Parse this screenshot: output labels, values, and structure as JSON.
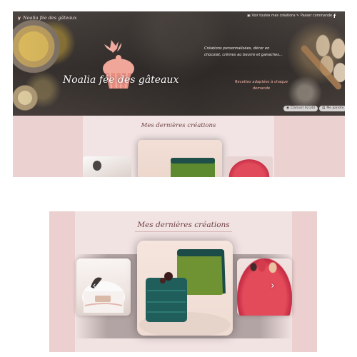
{
  "site": {
    "logo_text": "Noalia fée des gâteaux",
    "brand_name": "Noalia fée des gâteaux",
    "nav": {
      "creations": "Voir toutes mes créations",
      "contact": "Passer commande",
      "facebook": "f"
    },
    "tagline": "Créations personnalisées, décor en chocolat, crèmes au beurre et ganaches...",
    "subtagline": "Recettes adaptées à chaque demande",
    "pills": {
      "location": "Clamart 92140",
      "contact": "Me joindre"
    }
  },
  "gallery": {
    "title": "Mes dernières créations",
    "arrows": {
      "prev": "‹",
      "next": "›"
    },
    "images": [
      "white-cake-photo",
      "green-and-teal-cake-squares-photo",
      "red-glazed-entremet-photo"
    ]
  },
  "colors": {
    "hero_dark": "#3b3532",
    "accent_pink": "#f0a79a",
    "section_pink": "#ecd1d1",
    "panel_pink": "#f2e4e4",
    "title_brown": "#6d3f3f"
  }
}
